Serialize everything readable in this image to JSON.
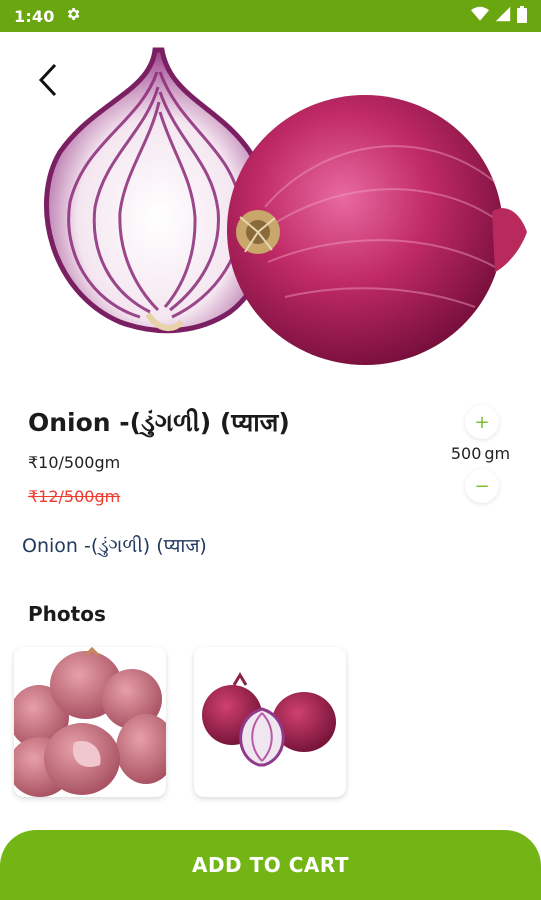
{
  "status_bar": {
    "time": "1:40",
    "icons": [
      "settings-icon",
      "wifi-icon",
      "signal-icon",
      "battery-icon"
    ]
  },
  "product": {
    "title": "Onion -(ડુંગળી) (प्याज)",
    "price": "₹10/500gm",
    "mrp": "₹12/500gm",
    "description": "Onion -(ડુંગળી) (प्याज)"
  },
  "quantity": {
    "increase_symbol": "+",
    "value": "500",
    "unit": "gm",
    "decrease_symbol": "−"
  },
  "photos": {
    "title": "Photos"
  },
  "cart": {
    "label": "ADD TO CART"
  },
  "colors": {
    "status_bar": "#69a60f",
    "accent": "#72b514",
    "mrp_red": "#ee3b2c",
    "description": "#223a5e"
  }
}
